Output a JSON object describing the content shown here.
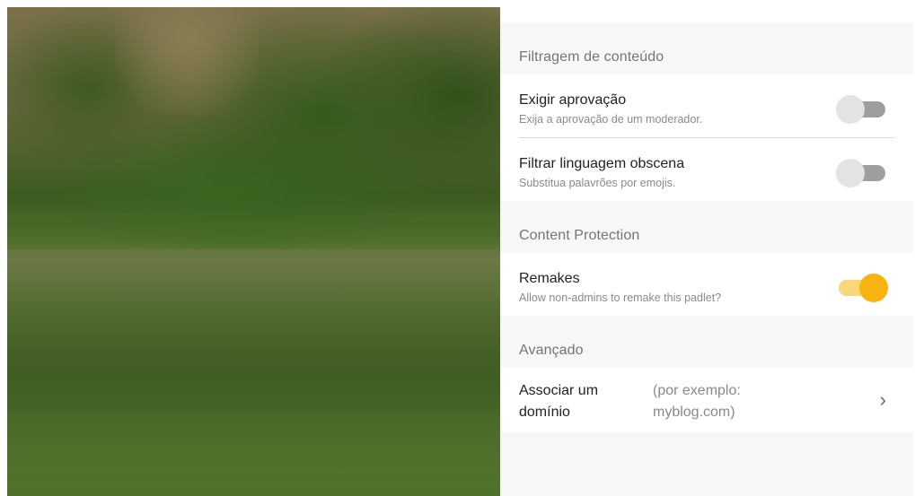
{
  "sections": {
    "content_filtering": {
      "header": "Filtragem de conteúdo",
      "require_approval": {
        "title": "Exigir aprovação",
        "subtitle": "Exija a aprovação de um moderador.",
        "enabled": false
      },
      "filter_profanity": {
        "title": "Filtrar linguagem obscena",
        "subtitle": "Substitua palavrões por emojis.",
        "enabled": false
      }
    },
    "content_protection": {
      "header": "Content Protection",
      "remakes": {
        "title": "Remakes",
        "subtitle": "Allow non-admins to remake this padlet?",
        "enabled": true
      }
    },
    "advanced": {
      "header": "Avançado",
      "domain": {
        "title": "Associar um domínio",
        "hint": "(por exemplo: myblog.com)"
      }
    }
  },
  "colors": {
    "toggle_on_knob": "#f9b311",
    "toggle_on_track": "#fad77a",
    "toggle_off_knob": "#e3e3e3",
    "toggle_off_track": "#9e9e9e"
  }
}
